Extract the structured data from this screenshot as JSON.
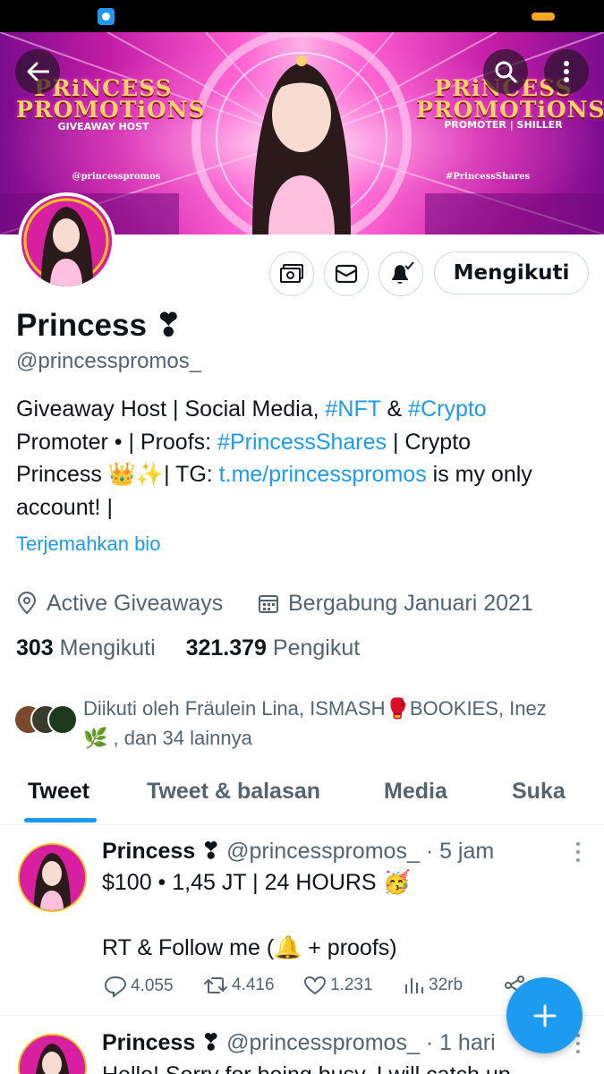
{
  "status_bar": {
    "app_icon": "app-notification-icon",
    "battery_color": "#f5a623"
  },
  "banner": {
    "left_title_line1": "PRiNCESS",
    "left_title_line2": "PROMOTiONS",
    "left_subtitle": "GIVEAWAY HOST",
    "left_handle": "@princesspromos",
    "right_title_line1": "PRiNCESS",
    "right_title_line2": "PROMOTiONS",
    "right_subtitle": "PROMOTER | SHILLER",
    "right_handle": "#PrincessShares",
    "back_icon": "back-arrow-icon",
    "search_icon": "search-icon",
    "more_icon": "more-vertical-icon"
  },
  "profile": {
    "name": "Princess",
    "name_emoji": "❣",
    "handle": "@princesspromos_",
    "follow_button": "Mengikuti",
    "bio_line1_text": "Giveaway Host | Social Media, ",
    "bio_tag_nft": "#NFT",
    "bio_amp": " & ",
    "bio_tag_crypto": "#Crypto",
    "bio_line2_text": "Promoter • | Proofs: ",
    "bio_tag_shares": "#PrincessShares",
    "bio_line2_end": " | Crypto",
    "bio_line3_text": "Princess 👑✨| TG: ",
    "bio_link": "t.me/princesspromos",
    "bio_line3_end": " is my only",
    "bio_line4_text": "account! |",
    "translate": "Terjemahkan bio",
    "location": "Active Giveaways",
    "joined": "Bergabung Januari 2021",
    "following_count": "303",
    "following_label": "Mengikuti",
    "followers_count": "321.379",
    "followers_label": "Pengikut",
    "followed_by_line1": "Diikuti oleh Fräulein Lina, ISMASH🥊BOOKIES, Inez",
    "followed_by_line2": "🌿 , dan 34 lainnya"
  },
  "tabs": [
    {
      "label": "Tweet"
    },
    {
      "label": "Tweet & balasan"
    },
    {
      "label": "Media"
    },
    {
      "label": "Suka"
    }
  ],
  "tweets": [
    {
      "name": "Princess",
      "name_emoji": "❣",
      "handle": "@princesspromos_",
      "time": "· 5 jam",
      "line1": "$100 • 1,45 JT | 24 HOURS 🥳",
      "line2": "RT & Follow me (🔔 + proofs)",
      "replies": "4.055",
      "retweets": "4.416",
      "likes": "1.231",
      "views": "32rb"
    },
    {
      "name": "Princess",
      "name_emoji": "❣",
      "handle": "@princesspromos_",
      "time": "· 1 hari",
      "line1": "Hello! Sorry for being busy, I will catch up"
    }
  ],
  "fab": {
    "icon": "plus-icon",
    "color": "#1d9bf0"
  },
  "colors": {
    "accent": "#1d9bf0",
    "text": "#0f1419",
    "muted": "#536471"
  }
}
